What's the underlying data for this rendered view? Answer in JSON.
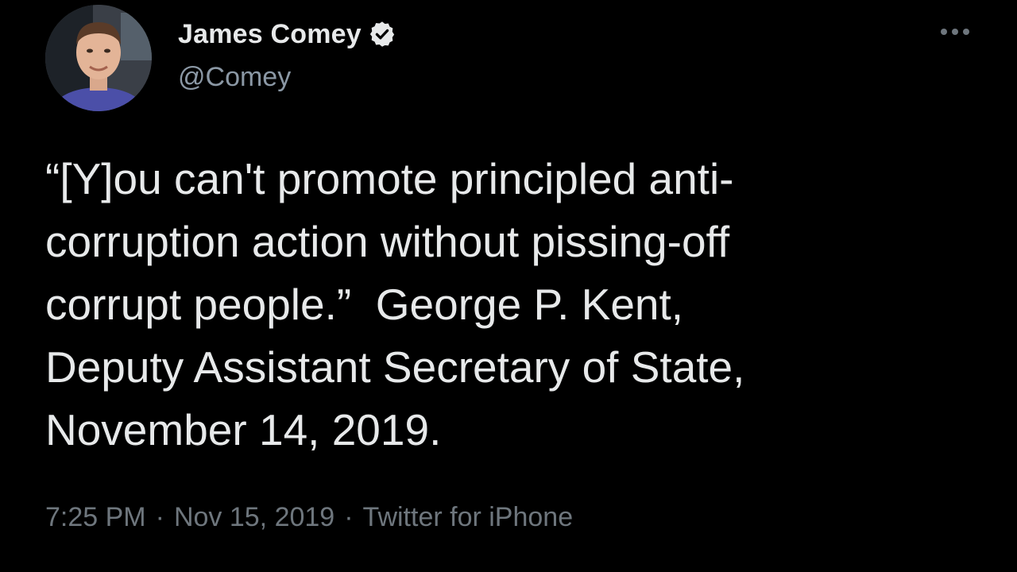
{
  "tweet": {
    "author": {
      "name": "James Comey",
      "handle": "@Comey",
      "verified": true
    },
    "text": "“[Y]ou can't promote principled anti-\ncorruption action without pissing-off\ncorrupt people.”  George P. Kent,\nDeputy Assistant Secretary of State,\nNovember 14, 2019.",
    "meta": {
      "time": "7:25 PM",
      "separator": "·",
      "date": "Nov 15, 2019",
      "source": "Twitter for iPhone"
    },
    "icons": {
      "verified": "verified-badge-icon",
      "more": "more-options-icon"
    }
  },
  "colors": {
    "background": "#000000",
    "text_primary": "#e7e9ea",
    "text_secondary": "#6e767d",
    "handle": "#8b98a5"
  }
}
